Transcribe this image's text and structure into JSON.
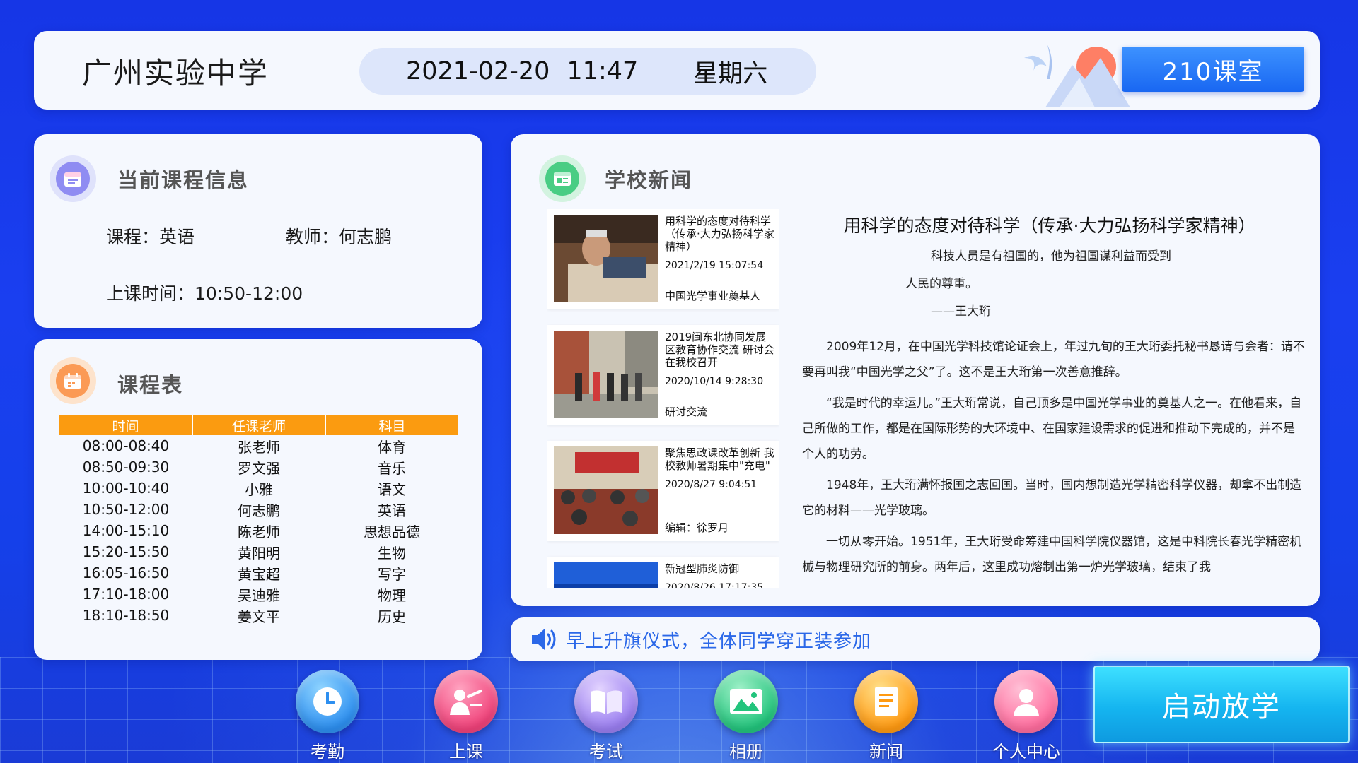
{
  "header": {
    "school_name": "广州实验中学",
    "date": "2021-02-20",
    "time": "11:47",
    "weekday": "星期六",
    "room_button": "210课室"
  },
  "course_info": {
    "title": "当前课程信息",
    "course_label": "课程：",
    "course_value": "英语",
    "teacher_label": "教师：",
    "teacher_value": "何志鹏",
    "time_label": "上课时间：",
    "time_value": "10:50-12:00"
  },
  "schedule": {
    "title": "课程表",
    "headers": [
      "时间",
      "任课老师",
      "科目"
    ],
    "rows": [
      [
        "08:00-08:40",
        "张老师",
        "体育"
      ],
      [
        "08:50-09:30",
        "罗文强",
        "音乐"
      ],
      [
        "10:00-10:40",
        "小雅",
        "语文"
      ],
      [
        "10:50-12:00",
        "何志鹏",
        "英语"
      ],
      [
        "14:00-15:10",
        "陈老师",
        "思想品德"
      ],
      [
        "15:20-15:50",
        "黄阳明",
        "生物"
      ],
      [
        "16:05-16:50",
        "黄宝超",
        "写字"
      ],
      [
        "17:10-18:00",
        "吴迪雅",
        "物理"
      ],
      [
        "18:10-18:50",
        "姜文平",
        "历史"
      ]
    ]
  },
  "news": {
    "title": "学校新闻",
    "items": [
      {
        "title": "用科学的态度对待科学（传承·大力弘扬科学家精神）",
        "date": "2021/2/19 15:07:54",
        "tag": "中国光学事业奠基人"
      },
      {
        "title": "2019闽东北协同发展区教育协作交流 研讨会在我校召开",
        "date": "2020/10/14 9:28:30",
        "tag": "研讨交流"
      },
      {
        "title": "聚焦思政课改革创新 我校教师暑期集中\"充电\"",
        "date": "2020/8/27 9:04:51",
        "tag": "编辑：徐罗月"
      },
      {
        "title": "新冠型肺炎防御",
        "date": "2020/8/26 17:17:35",
        "tag": ""
      }
    ],
    "article": {
      "title": "用科学的态度对待科学（传承·大力弘扬科学家精神）",
      "quote_line1": "科技人员是有祖国的，他为祖国谋利益而受到",
      "quote_line2": "人民的尊重。",
      "quote_author": "——王大珩",
      "paragraphs": [
        "2009年12月，在中国光学科技馆论证会上，年过九旬的王大珩委托秘书恳请与会者：请不要再叫我“中国光学之父”了。这不是王大珩第一次善意推辞。",
        "“我是时代的幸运儿。”王大珩常说，自己顶多是中国光学事业的奠基人之一。在他看来，自己所做的工作，都是在国际形势的大环境中、在国家建设需求的促进和推动下完成的，并不是个人的功劳。",
        "1948年，王大珩满怀报国之志回国。当时，国内想制造光学精密科学仪器，却拿不出制造它的材料——光学玻璃。",
        "一切从零开始。1951年，王大珩受命筹建中国科学院仪器馆，这是中科院长春光学精密机械与物理研究所的前身。两年后，这里成功熔制出第一炉光学玻璃，结束了我"
      ]
    }
  },
  "notice": {
    "text": "早上升旗仪式，全体同学穿正装参加"
  },
  "nav": {
    "items": [
      {
        "label": "考勤",
        "icon": "clock-icon",
        "color": "#3aa6ff"
      },
      {
        "label": "上课",
        "icon": "teacher-icon",
        "color": "#ff5a8c"
      },
      {
        "label": "考试",
        "icon": "book-icon",
        "color": "#a98bf5"
      },
      {
        "label": "相册",
        "icon": "image-icon",
        "color": "#32d38c"
      },
      {
        "label": "新闻",
        "icon": "document-icon",
        "color": "#ffab1f"
      },
      {
        "label": "个人中心",
        "icon": "user-icon",
        "color": "#ff7aa6"
      }
    ],
    "launch_button": "启动放学"
  }
}
